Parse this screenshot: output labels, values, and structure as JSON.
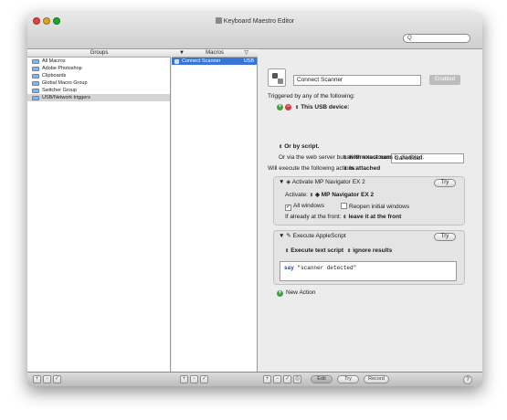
{
  "window": {
    "title": "Keyboard Maestro Editor",
    "search_placeholder": "Q"
  },
  "groups": {
    "header": "Groups",
    "items": [
      "All Macros",
      "Adobe Photoshop",
      "Clipboards",
      "Global Macro Group",
      "Switcher Group",
      "USB/Network triggers"
    ],
    "selected_index": 5
  },
  "macros": {
    "header": "Macros",
    "items": [
      {
        "name": "Connect Scanner",
        "badge": "USB"
      }
    ]
  },
  "editor": {
    "macro_name": "Connect Scanner",
    "enabled_label": "Enabled",
    "triggered_label": "Triggered by any of the following:",
    "usb_trigger_label": "This USB device:",
    "with_exact_name": "with exact name",
    "exact_name_value": "CanoScan",
    "is_attached": "is attached",
    "or_by_script": "Or by script.",
    "web_server_note": "Or via the web server but all remote access is disabled.",
    "will_execute_label": "Will execute the following actions:",
    "action1": {
      "title": "Activate MP Navigator EX 2",
      "try_label": "Try",
      "activate_label": "Activate:",
      "app_name": "MP Navigator EX 2",
      "all_windows_label": "All windows",
      "reopen_label": "Reopen initial windows",
      "front_label": "If already at the front:",
      "front_value": "leave it at the front"
    },
    "action2": {
      "title": "Execute AppleScript",
      "try_label": "Try",
      "mode": "Execute text script",
      "results": "ignore results",
      "script_keyword": "say",
      "script_text": " \"scanner detected\""
    },
    "new_action_label": "New Action"
  },
  "bottom": {
    "edit_label": "Edit",
    "try_label": "Try",
    "record_label": "Record",
    "help_label": "?"
  }
}
